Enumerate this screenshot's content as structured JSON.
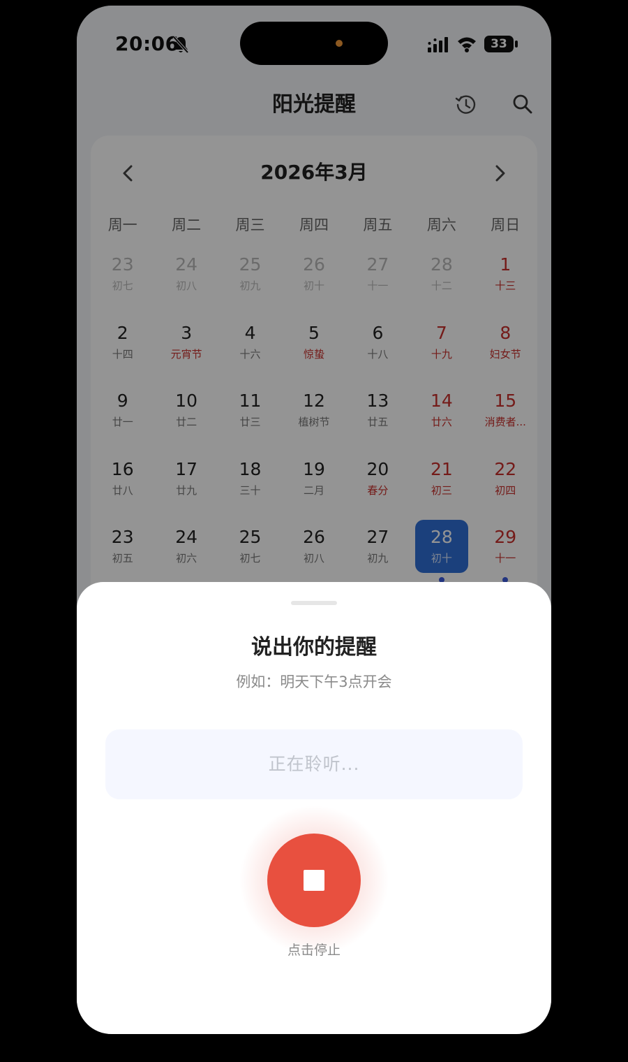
{
  "status_bar": {
    "time": "20:06",
    "battery": "33",
    "icons": [
      "bell-off-icon",
      "signal-icon",
      "wifi-icon",
      "battery-icon"
    ]
  },
  "header": {
    "title": "阳光提醒",
    "icons": [
      "history-icon",
      "search-icon"
    ]
  },
  "calendar": {
    "month_title": "2026年3月",
    "weekdays": [
      "周一",
      "周二",
      "周三",
      "周四",
      "周五",
      "周六",
      "周日"
    ],
    "weeks": [
      [
        {
          "num": "23",
          "lunar": "初七",
          "other": true
        },
        {
          "num": "24",
          "lunar": "初八",
          "other": true
        },
        {
          "num": "25",
          "lunar": "初九",
          "other": true
        },
        {
          "num": "26",
          "lunar": "初十",
          "other": true
        },
        {
          "num": "27",
          "lunar": "十一",
          "other": true
        },
        {
          "num": "28",
          "lunar": "十二",
          "other": true
        },
        {
          "num": "1",
          "lunar": "十三",
          "weekend": true,
          "red_lunar": true
        }
      ],
      [
        {
          "num": "2",
          "lunar": "十四"
        },
        {
          "num": "3",
          "lunar": "元宵节",
          "red_lunar": true
        },
        {
          "num": "4",
          "lunar": "十六"
        },
        {
          "num": "5",
          "lunar": "惊蛰",
          "red_lunar": true
        },
        {
          "num": "6",
          "lunar": "十八"
        },
        {
          "num": "7",
          "lunar": "十九",
          "weekend": true,
          "red_lunar": true
        },
        {
          "num": "8",
          "lunar": "妇女节",
          "weekend": true,
          "red_lunar": true
        }
      ],
      [
        {
          "num": "9",
          "lunar": "廿一"
        },
        {
          "num": "10",
          "lunar": "廿二"
        },
        {
          "num": "11",
          "lunar": "廿三"
        },
        {
          "num": "12",
          "lunar": "植树节"
        },
        {
          "num": "13",
          "lunar": "廿五"
        },
        {
          "num": "14",
          "lunar": "廿六",
          "weekend": true,
          "red_lunar": true
        },
        {
          "num": "15",
          "lunar": "消费者...",
          "weekend": true,
          "red_lunar": true
        }
      ],
      [
        {
          "num": "16",
          "lunar": "廿八"
        },
        {
          "num": "17",
          "lunar": "廿九"
        },
        {
          "num": "18",
          "lunar": "三十"
        },
        {
          "num": "19",
          "lunar": "二月"
        },
        {
          "num": "20",
          "lunar": "春分",
          "red_lunar": true
        },
        {
          "num": "21",
          "lunar": "初三",
          "weekend": true,
          "red_lunar": true
        },
        {
          "num": "22",
          "lunar": "初四",
          "weekend": true,
          "red_lunar": true
        }
      ],
      [
        {
          "num": "23",
          "lunar": "初五"
        },
        {
          "num": "24",
          "lunar": "初六"
        },
        {
          "num": "25",
          "lunar": "初七"
        },
        {
          "num": "26",
          "lunar": "初八"
        },
        {
          "num": "27",
          "lunar": "初九"
        },
        {
          "num": "28",
          "lunar": "初十",
          "today": true,
          "dot": true
        },
        {
          "num": "29",
          "lunar": "十一",
          "weekend": true,
          "red_lunar": true,
          "dot": true
        }
      ]
    ]
  },
  "sheet": {
    "title": "说出你的提醒",
    "hint": "例如：明天下午3点开会",
    "listening": "正在聆听...",
    "stop_label": "点击停止"
  },
  "colors": {
    "accent_blue": "#2f6fd6",
    "holiday_red": "#c9302c",
    "stop_red": "#e8503f"
  }
}
